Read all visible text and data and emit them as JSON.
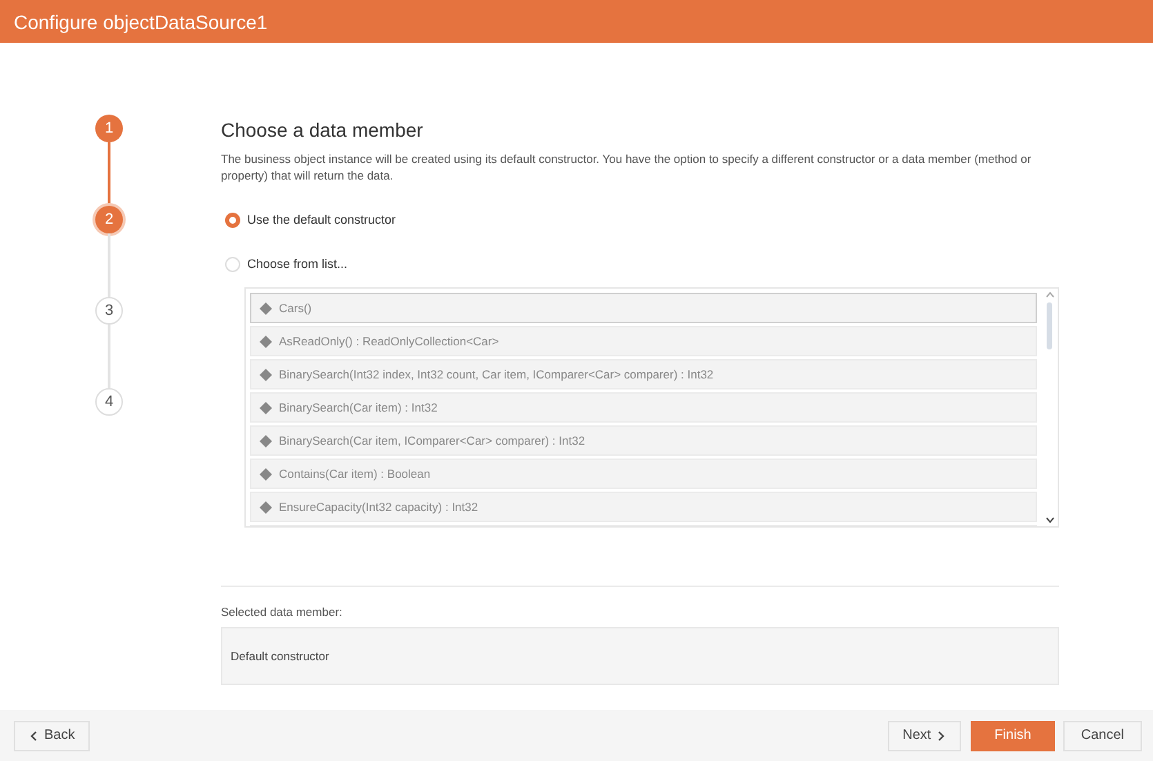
{
  "window": {
    "title": "Configure objectDataSource1"
  },
  "steps": [
    {
      "label": "1",
      "kind": "done"
    },
    {
      "label": "2",
      "kind": "current"
    },
    {
      "label": "3",
      "kind": "pending"
    },
    {
      "label": "4",
      "kind": "pending"
    }
  ],
  "page": {
    "title": "Choose a data member",
    "description": "The business object instance will be created using its default constructor. You have the option to specify a different constructor or a data member (method or property) that will return the data."
  },
  "options": [
    {
      "label": "Use the default constructor",
      "selected": true
    },
    {
      "label": "Choose from list...",
      "selected": false
    }
  ],
  "member_list": {
    "disabled": true,
    "items": [
      {
        "label": "Cars()",
        "selected": true
      },
      {
        "label": "AsReadOnly() : ReadOnlyCollection<Car>",
        "selected": false
      },
      {
        "label": "BinarySearch(Int32 index, Int32 count, Car item, IComparer<Car> comparer) : Int32",
        "selected": false
      },
      {
        "label": "BinarySearch(Car item) : Int32",
        "selected": false
      },
      {
        "label": "BinarySearch(Car item, IComparer<Car> comparer) : Int32",
        "selected": false
      },
      {
        "label": "Contains(Car item) : Boolean",
        "selected": false
      },
      {
        "label": "EnsureCapacity(Int32 capacity) : Int32",
        "selected": false
      }
    ]
  },
  "selected_member": {
    "label": "Selected data member:",
    "value": "Default constructor"
  },
  "buttons": {
    "back": "Back",
    "next": "Next",
    "finish": "Finish",
    "cancel": "Cancel"
  }
}
